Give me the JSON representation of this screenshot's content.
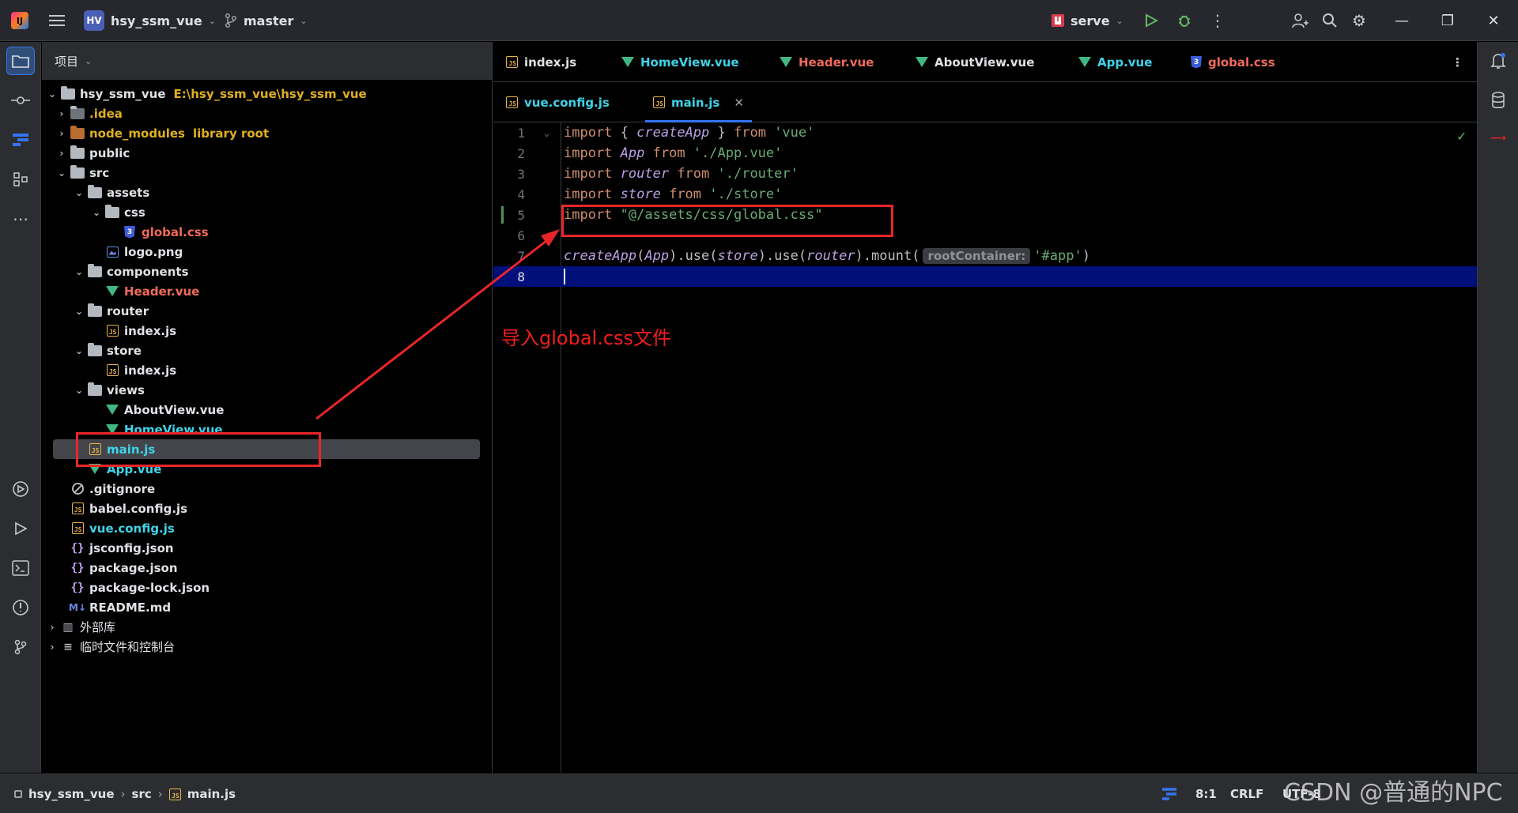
{
  "titlebar": {
    "project_badge": "HV",
    "project_name": "hsy_ssm_vue",
    "branch": "master",
    "run_config": "serve"
  },
  "project_panel": {
    "title": "项目",
    "tree": [
      {
        "label": "hsy_ssm_vue",
        "extra": "E:\\hsy_ssm_vue\\hsy_ssm_vue",
        "icon": "folder-icon"
      },
      {
        "label": ".idea",
        "icon": "folder-icon"
      },
      {
        "label": "node_modules",
        "extra": "library root",
        "icon": "folder-icon"
      },
      {
        "label": "public",
        "icon": "folder-icon"
      },
      {
        "label": "src",
        "icon": "folder-icon"
      },
      {
        "label": "assets",
        "icon": "folder-icon"
      },
      {
        "label": "css",
        "icon": "folder-icon"
      },
      {
        "label": "global.css",
        "icon": "css-file-icon"
      },
      {
        "label": "logo.png",
        "icon": "image-file-icon"
      },
      {
        "label": "components",
        "icon": "folder-icon"
      },
      {
        "label": "Header.vue",
        "icon": "vue-file-icon"
      },
      {
        "label": "router",
        "icon": "folder-icon"
      },
      {
        "label": "index.js",
        "icon": "js-file-icon"
      },
      {
        "label": "store",
        "icon": "folder-icon"
      },
      {
        "label": "index.js",
        "icon": "js-file-icon"
      },
      {
        "label": "views",
        "icon": "folder-icon"
      },
      {
        "label": "AboutView.vue",
        "icon": "vue-file-icon"
      },
      {
        "label": "HomeView.vue",
        "icon": "vue-file-icon"
      },
      {
        "label": "main.js",
        "icon": "js-file-icon"
      },
      {
        "label": "App.vue",
        "icon": "vue-file-icon"
      },
      {
        "label": ".gitignore",
        "icon": "ignore-file-icon"
      },
      {
        "label": "babel.config.js",
        "icon": "js-file-icon"
      },
      {
        "label": "vue.config.js",
        "icon": "js-file-icon"
      },
      {
        "label": "jsconfig.json",
        "icon": "json-file-icon"
      },
      {
        "label": "package.json",
        "icon": "json-file-icon"
      },
      {
        "label": "package-lock.json",
        "icon": "json-file-icon"
      },
      {
        "label": "README.md",
        "icon": "markdown-file-icon"
      },
      {
        "label": "外部库",
        "icon": "library-icon"
      },
      {
        "label": "临时文件和控制台",
        "icon": "scratches-icon"
      }
    ]
  },
  "editor": {
    "tabs_row1": [
      "index.js",
      "HomeView.vue",
      "Header.vue",
      "AboutView.vue",
      "App.vue",
      "global.css"
    ],
    "tabs_row2": [
      "vue.config.js",
      "main.js"
    ],
    "line_numbers": [
      "1",
      "2",
      "3",
      "4",
      "5",
      "6",
      "7",
      "8"
    ],
    "code": {
      "l1": {
        "kw": "import",
        "p1": " { ",
        "fn": "createApp",
        "p2": " } ",
        "kw2": "from",
        "str": " 'vue'"
      },
      "l2": {
        "kw": "import",
        "fn": " App",
        "kw2": " from",
        "str": " './App.vue'"
      },
      "l3": {
        "kw": "import",
        "fn": " router",
        "kw2": " from",
        "str": " './router'"
      },
      "l4": {
        "kw": "import",
        "fn": " store",
        "kw2": " from",
        "str": " './store'"
      },
      "l5": {
        "kw": "import",
        "str": " \"@/assets/css/global.css\""
      },
      "l7": {
        "fn1": "createApp",
        "p1": "(",
        "fn2": "App",
        "p2": ").use(",
        "fn3": "store",
        "p3": ").use(",
        "fn4": "router",
        "p4": ").mount(",
        "hint": "rootContainer:",
        "str": "'#app'",
        "p5": ")"
      }
    }
  },
  "annotation": {
    "text": "导入global.css文件"
  },
  "statusbar": {
    "crumbs": [
      "hsy_ssm_vue",
      "src",
      "main.js"
    ],
    "position": "8:1",
    "line_sep": "CRLF",
    "encoding": "UTF-8"
  },
  "watermark": "CSDN @普通的NPC",
  "colors": {
    "keyword": "#cf8e6d",
    "identifier": "#b8a1e3",
    "string": "#6aab73",
    "current_line": "#000f7a",
    "annotation_red": "#e8262a"
  }
}
